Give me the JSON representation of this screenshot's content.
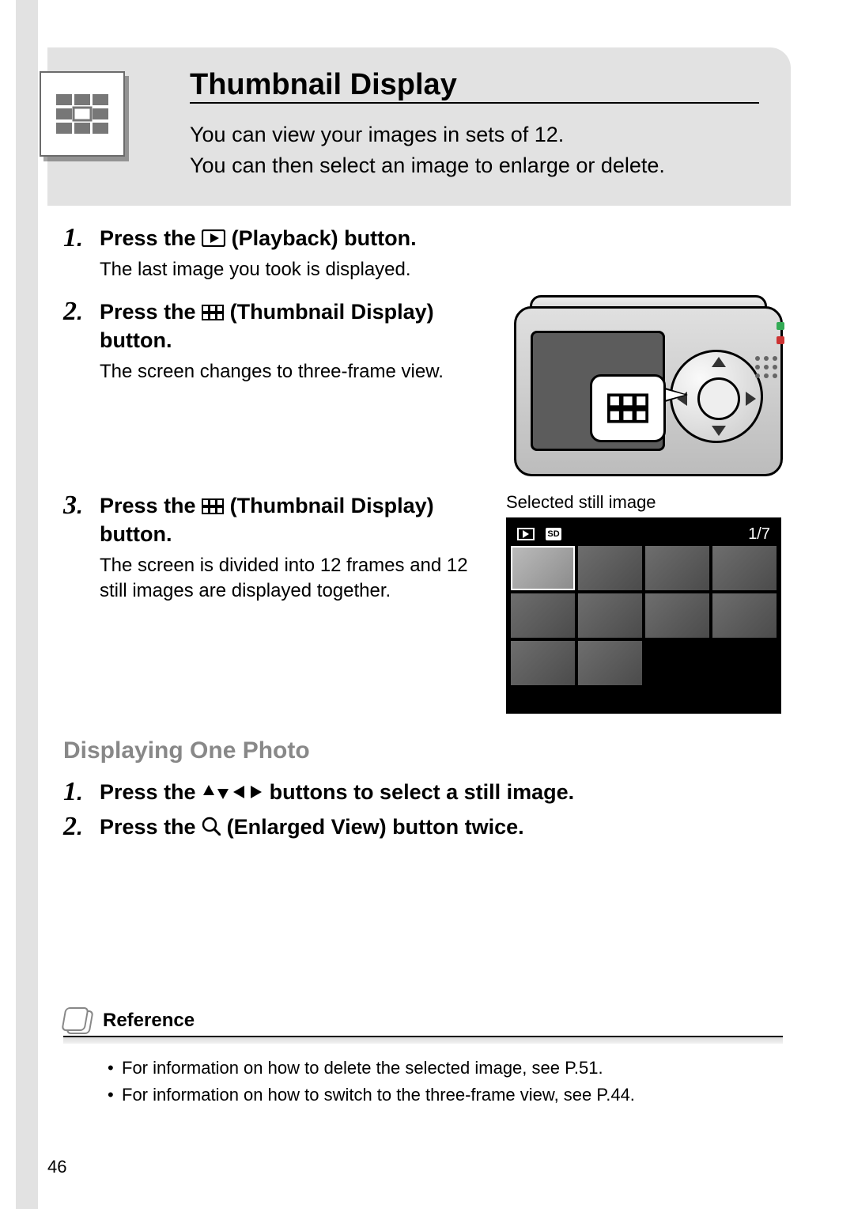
{
  "header": {
    "title": "Thumbnail Display",
    "intro_line1": "You can view your images in sets of 12.",
    "intro_line2": "You can then select an image to enlarge or delete."
  },
  "steps_a": [
    {
      "num": "1",
      "head_pre": "Press the ",
      "icon": "playback",
      "head_post": " (Playback) button.",
      "sub": "The last image you took is displayed."
    },
    {
      "num": "2",
      "head_pre": "Press the ",
      "icon": "thumbnail",
      "head_post": " (Thumbnail Display) button.",
      "sub": "The screen changes to three-frame view."
    },
    {
      "num": "3",
      "head_pre": "Press the ",
      "icon": "thumbnail",
      "head_post": " (Thumbnail Display) button.",
      "sub": "The screen is divided into 12 frames and 12 still images are displayed together."
    }
  ],
  "preview": {
    "caption": "Selected still image",
    "counter": "1/7",
    "sd_label": "SD"
  },
  "subhead": "Displaying One Photo",
  "steps_b": [
    {
      "num": "1",
      "head_pre": "Press the ",
      "icon": "arrows4",
      "head_post": " buttons to select a still image."
    },
    {
      "num": "2",
      "head_pre": "Press the ",
      "icon": "magnify",
      "head_post": " (Enlarged View) button twice."
    }
  ],
  "reference": {
    "title": "Reference",
    "items": [
      "For information on how to delete the selected image, see P.51.",
      "For information on how to switch to the three-frame view, see P.44."
    ]
  },
  "page_number": "46"
}
